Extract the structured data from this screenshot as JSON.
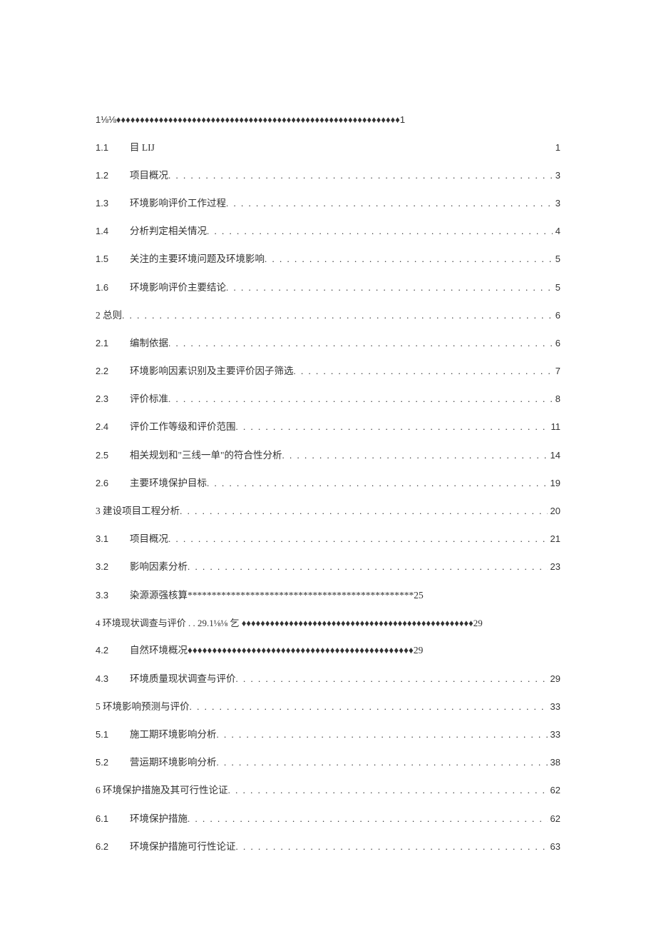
{
  "toc": {
    "line_top": {
      "raw": "1⅛⅛♦♦♦♦♦♦♦♦♦♦♦♦♦♦♦♦♦♦♦♦♦♦♦♦♦♦♦♦♦♦♦♦♦♦♦♦♦♦♦♦♦♦♦♦♦♦♦♦♦♦♦♦♦♦♦♦♦♦♦♦1"
    },
    "entries": [
      {
        "num": "1.1",
        "title": "目 LIJ",
        "page": "1",
        "leader": "none"
      },
      {
        "num": "1.2",
        "title": "项目概况",
        "page": "3",
        "leader": "dots"
      },
      {
        "num": "1.3",
        "title": "环境影响评价工作过程",
        "page": "3",
        "leader": "dots"
      },
      {
        "num": "1.4",
        "title": "分析判定相关情况",
        "page": "4",
        "leader": "dots"
      },
      {
        "num": "1.5",
        "title": "关注的主要环境问题及环境影响",
        "page": "5",
        "leader": "dots"
      },
      {
        "num": "1.6",
        "title": "环境影响评价主要结论",
        "page": "5",
        "leader": "dots"
      },
      {
        "section": true,
        "title": "2 总则",
        "page": "6",
        "leader": "dots"
      },
      {
        "num": "2.1",
        "title": "编制依据",
        "page": "6",
        "leader": "dots"
      },
      {
        "num": "2.2",
        "title": "环境影响因素识别及主要评价因子筛选",
        "page": "7",
        "leader": "dots"
      },
      {
        "num": "2.3",
        "title": "评价标准",
        "page": "8",
        "leader": "dots"
      },
      {
        "num": "2.4",
        "title": "评价工作等级和评价范围",
        "page": "11",
        "leader": "dots"
      },
      {
        "num": "2.5",
        "title": "相关规划和\"三线一单\"的符合性分析",
        "page": "14",
        "leader": "dots"
      },
      {
        "num": "2.6",
        "title": "主要环境保护目标",
        "page": "19",
        "leader": "dots"
      },
      {
        "section": true,
        "title": "3 建设项目工程分析",
        "page": "20",
        "leader": "dots"
      },
      {
        "num": "3.1",
        "title": "项目概况",
        "page": "21",
        "leader": "dots"
      },
      {
        "num": "3.2",
        "title": "影响因素分析",
        "page": "23",
        "leader": "dots"
      },
      {
        "num": "3.3",
        "title_raw": "染源源强核算***********************************************25",
        "raw_sub": true
      },
      {
        "section_raw": true,
        "title_raw": "4 环境现状调查与评价 . . 29.1⅛⅛ 乞  ♦♦♦♦♦♦♦♦♦♦♦♦♦♦♦♦♦♦♦♦♦♦♦♦♦♦♦♦♦♦♦♦♦♦♦♦♦♦♦♦♦♦♦♦♦♦♦♦♦29"
      },
      {
        "num": "4.2",
        "title_raw": "自然环境概况♦♦♦♦♦♦♦♦♦♦♦♦♦♦♦♦♦♦♦♦♦♦♦♦♦♦♦♦♦♦♦♦♦♦♦♦♦♦♦♦♦♦♦♦♦♦29",
        "raw_sub": true
      },
      {
        "num": "4.3",
        "title": "环境质量现状调查与评价",
        "page": "29",
        "leader": "dots"
      },
      {
        "section": true,
        "title": "5 环境影响预测与评价",
        "page": "33",
        "leader": "dots"
      },
      {
        "num": "5.1",
        "title": "施工期环境影响分析",
        "page": "33",
        "leader": "dots"
      },
      {
        "num": "5.2",
        "title": "营运期环境影响分析",
        "page": "38",
        "leader": "dots"
      },
      {
        "section": true,
        "title": "6 环境保护措施及其可行性论证",
        "page": "62",
        "leader": "dots"
      },
      {
        "num": "6.1",
        "title": "环境保护措施",
        "page": "62",
        "leader": "dots"
      },
      {
        "num": "6.2",
        "title": "环境保护措施可行性论证",
        "page": "63",
        "leader": "dots"
      }
    ],
    "leaders": {
      "dots": ". . . . . . . . . . . . . . . . . . . . . . . . . . . . . . . . . . . . . . . . . . . . . . . . . . . . . . . . . . . . . . . . . . . . . . . . . . . . . . . . . . . . . . . . . . . . . . . . . . . . . . . . . . . . . . . . . . . . . . . .",
      "none": ""
    }
  }
}
